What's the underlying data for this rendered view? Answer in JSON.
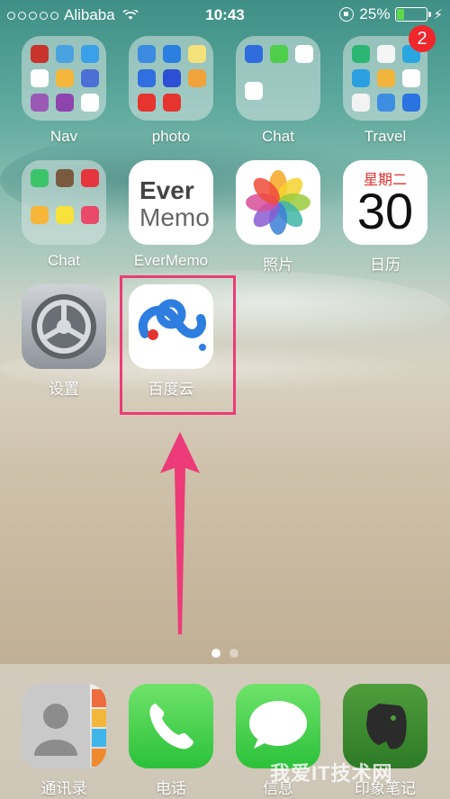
{
  "status_bar": {
    "carrier": "Alibaba",
    "time": "10:43",
    "battery": "25%",
    "battery_level": 0.25,
    "battery_color": "#5ed84c"
  },
  "rows": [
    [
      {
        "label": "Nav",
        "kind": "folder"
      },
      {
        "label": "photo",
        "kind": "folder"
      },
      {
        "label": "Chat",
        "kind": "folder"
      },
      {
        "label": "Travel",
        "kind": "folder",
        "badge": "2"
      }
    ],
    [
      {
        "label": "Chat",
        "kind": "folder"
      },
      {
        "label": "EverMemo",
        "kind": "app",
        "icon_text_1": "Ever",
        "icon_text_2": "Memo"
      },
      {
        "label": "照片",
        "kind": "app"
      },
      {
        "label": "日历",
        "kind": "app",
        "weekday": "星期二",
        "day": "30"
      }
    ],
    [
      {
        "label": "设置",
        "kind": "app"
      },
      {
        "label": "百度云",
        "kind": "app"
      }
    ]
  ],
  "dock": [
    {
      "label": "通讯录"
    },
    {
      "label": "电话"
    },
    {
      "label": "信息"
    },
    {
      "label": "印象笔记"
    }
  ],
  "page_indicator": {
    "pages": 2,
    "current": 1
  },
  "watermark": "我爱IT技术网",
  "colors": {
    "highlight": "#ec3b78",
    "badge": "#f0262b"
  }
}
